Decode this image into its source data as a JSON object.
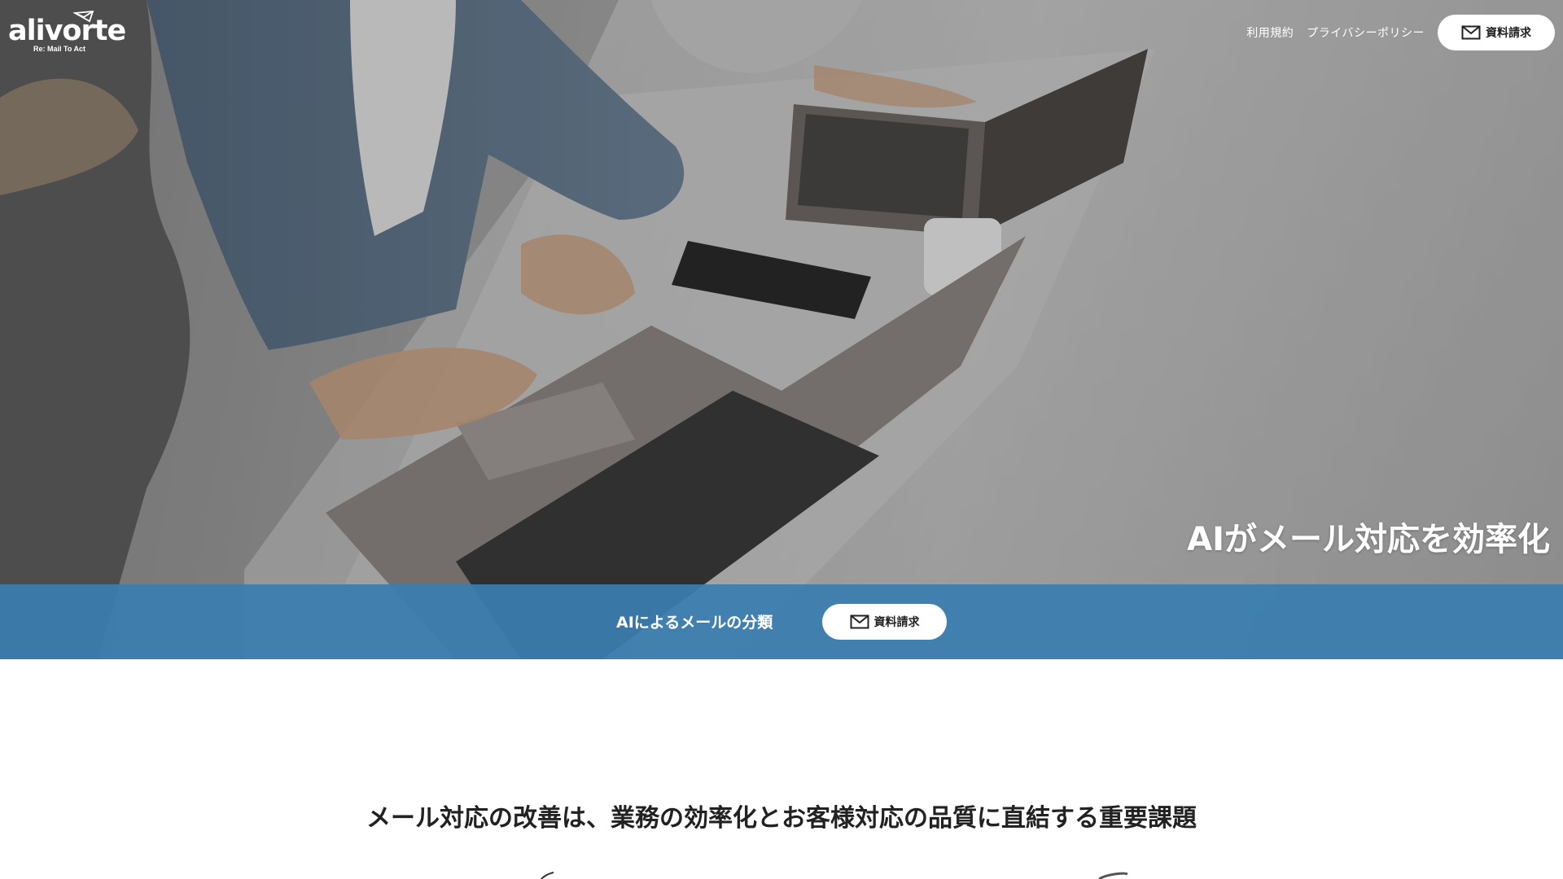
{
  "logo": {
    "wordmark": "alivorte",
    "tagline": "Re: Mail To Act"
  },
  "nav": {
    "links": [
      "利用規約",
      "プライバシーポリシー"
    ],
    "cta_label": "資料請求"
  },
  "hero": {
    "headline": "AIがメール対応を効率化"
  },
  "band": {
    "label": "AIによるメールの分類",
    "cta_label": "資料請求"
  },
  "intro": {
    "heading": "メール対応の改善は、業務の効率化とお客様対応の品質に直結する重要課題"
  },
  "icons": {
    "cta": "mail-icon",
    "logo": "envelope-logo-mark"
  },
  "colors": {
    "band": "#3a7eaf",
    "text_dark": "#222222",
    "button_bg": "#ffffff"
  }
}
